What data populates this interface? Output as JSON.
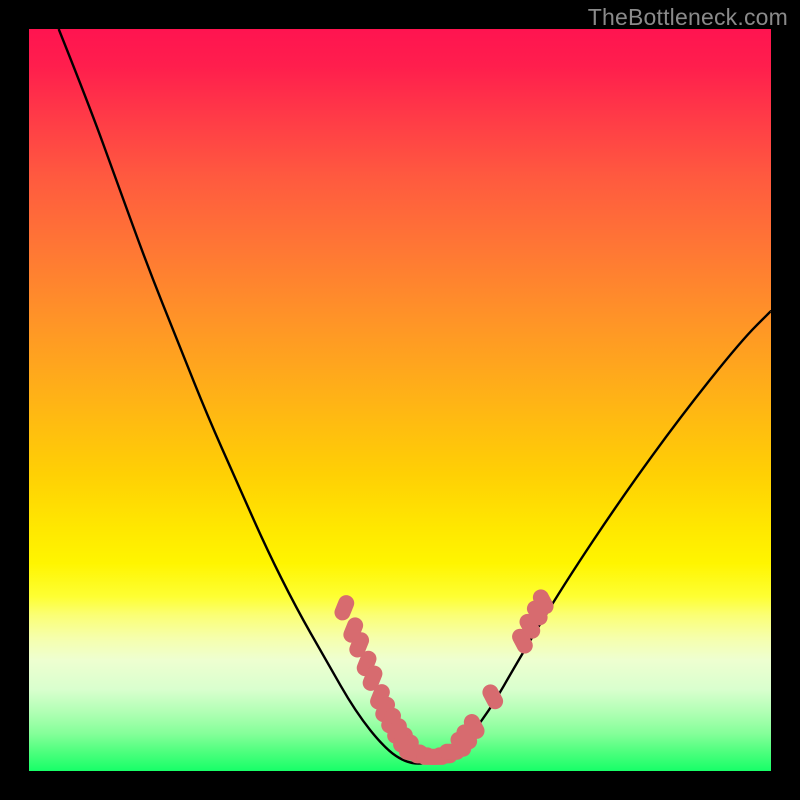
{
  "watermark": "TheBottleneck.com",
  "colors": {
    "frame": "#000000",
    "curve_stroke": "#000000",
    "marker_fill": "#d76b6f",
    "gradient_top": "#ff1450",
    "gradient_bottom": "#17ff68"
  },
  "chart_data": {
    "type": "line",
    "title": "",
    "xlabel": "",
    "ylabel": "",
    "xlim": [
      0,
      100
    ],
    "ylim": [
      0,
      100
    ],
    "grid": false,
    "legend": false,
    "curve_points": [
      {
        "x": 4,
        "y": 100
      },
      {
        "x": 8,
        "y": 90
      },
      {
        "x": 12,
        "y": 79
      },
      {
        "x": 16,
        "y": 68
      },
      {
        "x": 20,
        "y": 58
      },
      {
        "x": 24,
        "y": 48
      },
      {
        "x": 28,
        "y": 39
      },
      {
        "x": 32,
        "y": 30
      },
      {
        "x": 36,
        "y": 22
      },
      {
        "x": 40,
        "y": 15
      },
      {
        "x": 44,
        "y": 8
      },
      {
        "x": 48,
        "y": 3
      },
      {
        "x": 51,
        "y": 1
      },
      {
        "x": 54,
        "y": 1
      },
      {
        "x": 58,
        "y": 3
      },
      {
        "x": 62,
        "y": 8
      },
      {
        "x": 66,
        "y": 15
      },
      {
        "x": 72,
        "y": 25
      },
      {
        "x": 80,
        "y": 37
      },
      {
        "x": 88,
        "y": 48
      },
      {
        "x": 96,
        "y": 58
      },
      {
        "x": 100,
        "y": 62
      }
    ],
    "markers_left": [
      {
        "x": 42.5,
        "y": 22
      },
      {
        "x": 43.7,
        "y": 19
      },
      {
        "x": 44.5,
        "y": 17
      },
      {
        "x": 45.5,
        "y": 14.5
      },
      {
        "x": 46.3,
        "y": 12.5
      },
      {
        "x": 47.3,
        "y": 10
      },
      {
        "x": 48.0,
        "y": 8.3
      },
      {
        "x": 48.8,
        "y": 6.8
      },
      {
        "x": 49.6,
        "y": 5.4
      },
      {
        "x": 50.4,
        "y": 4.2
      },
      {
        "x": 51.2,
        "y": 3.2
      }
    ],
    "markers_bottom": [
      {
        "x": 52.0,
        "y": 2.5
      },
      {
        "x": 53.0,
        "y": 2.1
      },
      {
        "x": 54.0,
        "y": 1.9
      },
      {
        "x": 55.0,
        "y": 1.9
      },
      {
        "x": 56.0,
        "y": 2.1
      },
      {
        "x": 57.0,
        "y": 2.6
      }
    ],
    "markers_right": [
      {
        "x": 58.2,
        "y": 3.6
      },
      {
        "x": 59.0,
        "y": 4.6
      },
      {
        "x": 60.0,
        "y": 6.0
      },
      {
        "x": 62.5,
        "y": 10.0
      },
      {
        "x": 66.5,
        "y": 17.5
      },
      {
        "x": 67.5,
        "y": 19.5
      },
      {
        "x": 68.5,
        "y": 21.3
      },
      {
        "x": 69.3,
        "y": 22.8
      }
    ]
  }
}
